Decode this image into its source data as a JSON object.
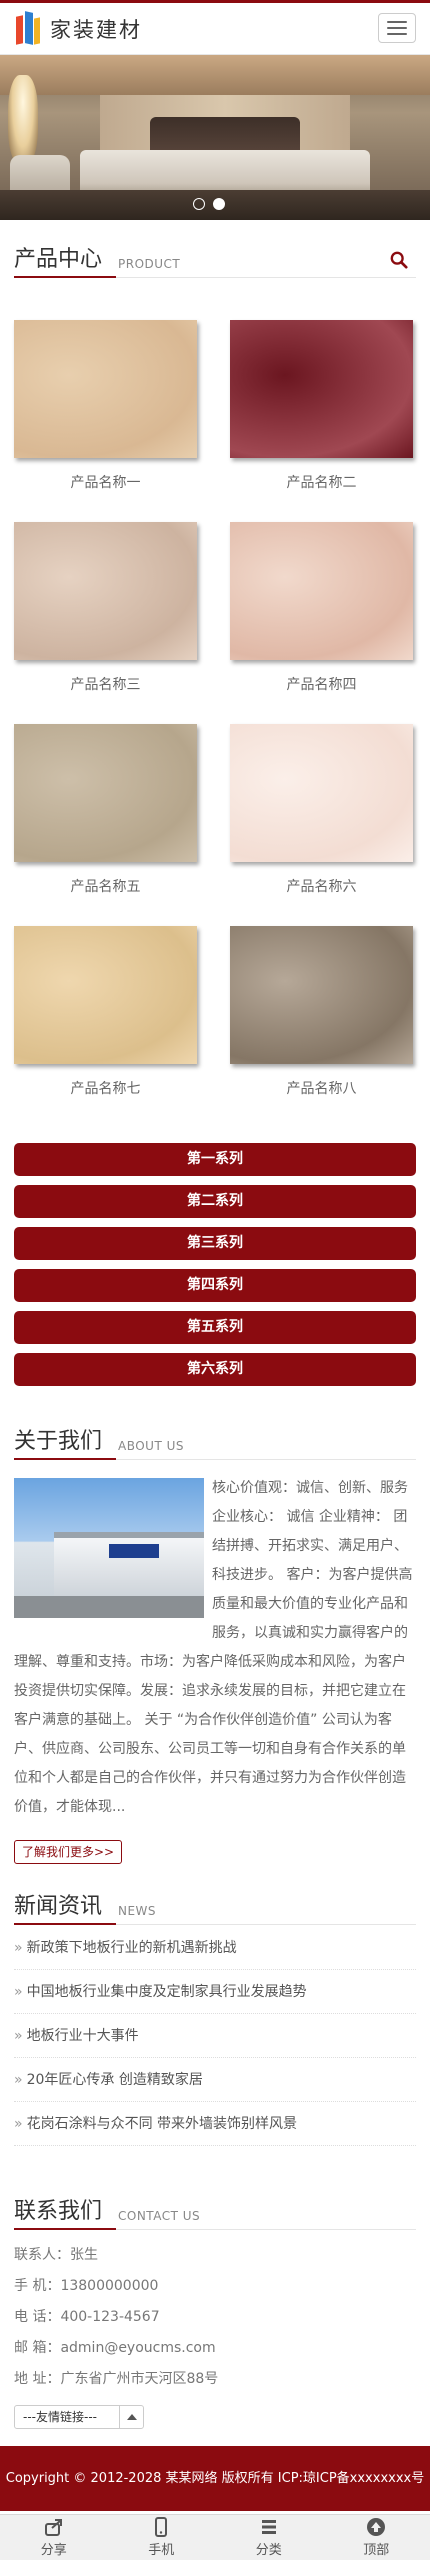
{
  "header": {
    "logo_text": "家装建材",
    "menu_icon": "hamburger-menu-icon"
  },
  "banner": {
    "dots": 2,
    "active_dot": 2
  },
  "products": {
    "title": "产品中心",
    "subtitle": "PRODUCT",
    "items": [
      {
        "name": "产品名称一",
        "colors": [
          "#e8cfae",
          "#d9b893"
        ]
      },
      {
        "name": "产品名称二",
        "colors": [
          "#6b1620",
          "#a04852"
        ]
      },
      {
        "name": "产品名称三",
        "colors": [
          "#e6d2c2",
          "#cdb3a0"
        ]
      },
      {
        "name": "产品名称四",
        "colors": [
          "#f1d9cc",
          "#e0b8a6"
        ]
      },
      {
        "name": "产品名称五",
        "colors": [
          "#cdbfa9",
          "#b6a68c"
        ]
      },
      {
        "name": "产品名称六",
        "colors": [
          "#fbefe9",
          "#f3ddd3"
        ]
      },
      {
        "name": "产品名称七",
        "colors": [
          "#efd7ae",
          "#dcbf8c"
        ]
      },
      {
        "name": "产品名称八",
        "colors": [
          "#b6a898",
          "#857665"
        ]
      }
    ]
  },
  "series": [
    "第一系列",
    "第二系列",
    "第三系列",
    "第四系列",
    "第五系列",
    "第六系列"
  ],
  "about": {
    "title": "关于我们",
    "subtitle": "ABOUT US",
    "text": "核心价值观：诚信、创新、服务企业核心： 诚信 企业精神： 团结拼搏、开拓求实、满足用户、科技进步。 客户：为客户提供高质量和最大价值的专业化产品和服务，以真诚和实力赢得客户的理解、尊重和支持。市场：为客户降低采购成本和风险，为客户投资提供切实保障。发展：追求永续发展的目标，并把它建立在客户满意的基础上。 关于 “为合作伙伴创造价值” 公司认为客户、供应商、公司股东、公司员工等一切和自身有合作关系的单位和个人都是自己的合作伙伴，并只有通过努力为合作伙伴创造价值，才能体现...",
    "more": "了解我们更多>>"
  },
  "news": {
    "title": "新闻资讯",
    "subtitle": "NEWS",
    "items": [
      "新政策下地板行业的新机遇新挑战",
      "中国地板行业集中度及定制家具行业发展趋势",
      "地板行业十大事件",
      "20年匠心传承 创造精致家居",
      "花岗石涂料与众不同 带来外墙装饰别样风景"
    ]
  },
  "contact": {
    "title": "联系我们",
    "subtitle": "CONTACT US",
    "lines": [
      "联系人：张生",
      "手 机：13800000000",
      "电 话：400-123-4567",
      "邮 箱：admin@eyoucms.com",
      "地 址：广东省广州市天河区88号"
    ],
    "friend_links": "---友情链接---"
  },
  "footer": {
    "copyright": "Copyright © 2012-2028 某某网络 版权所有 ICP:琼ICP备xxxxxxxx号"
  },
  "bottom_nav": [
    "分享",
    "手机",
    "分类",
    "顶部"
  ],
  "colors": {
    "accent": "#8b0b10"
  }
}
